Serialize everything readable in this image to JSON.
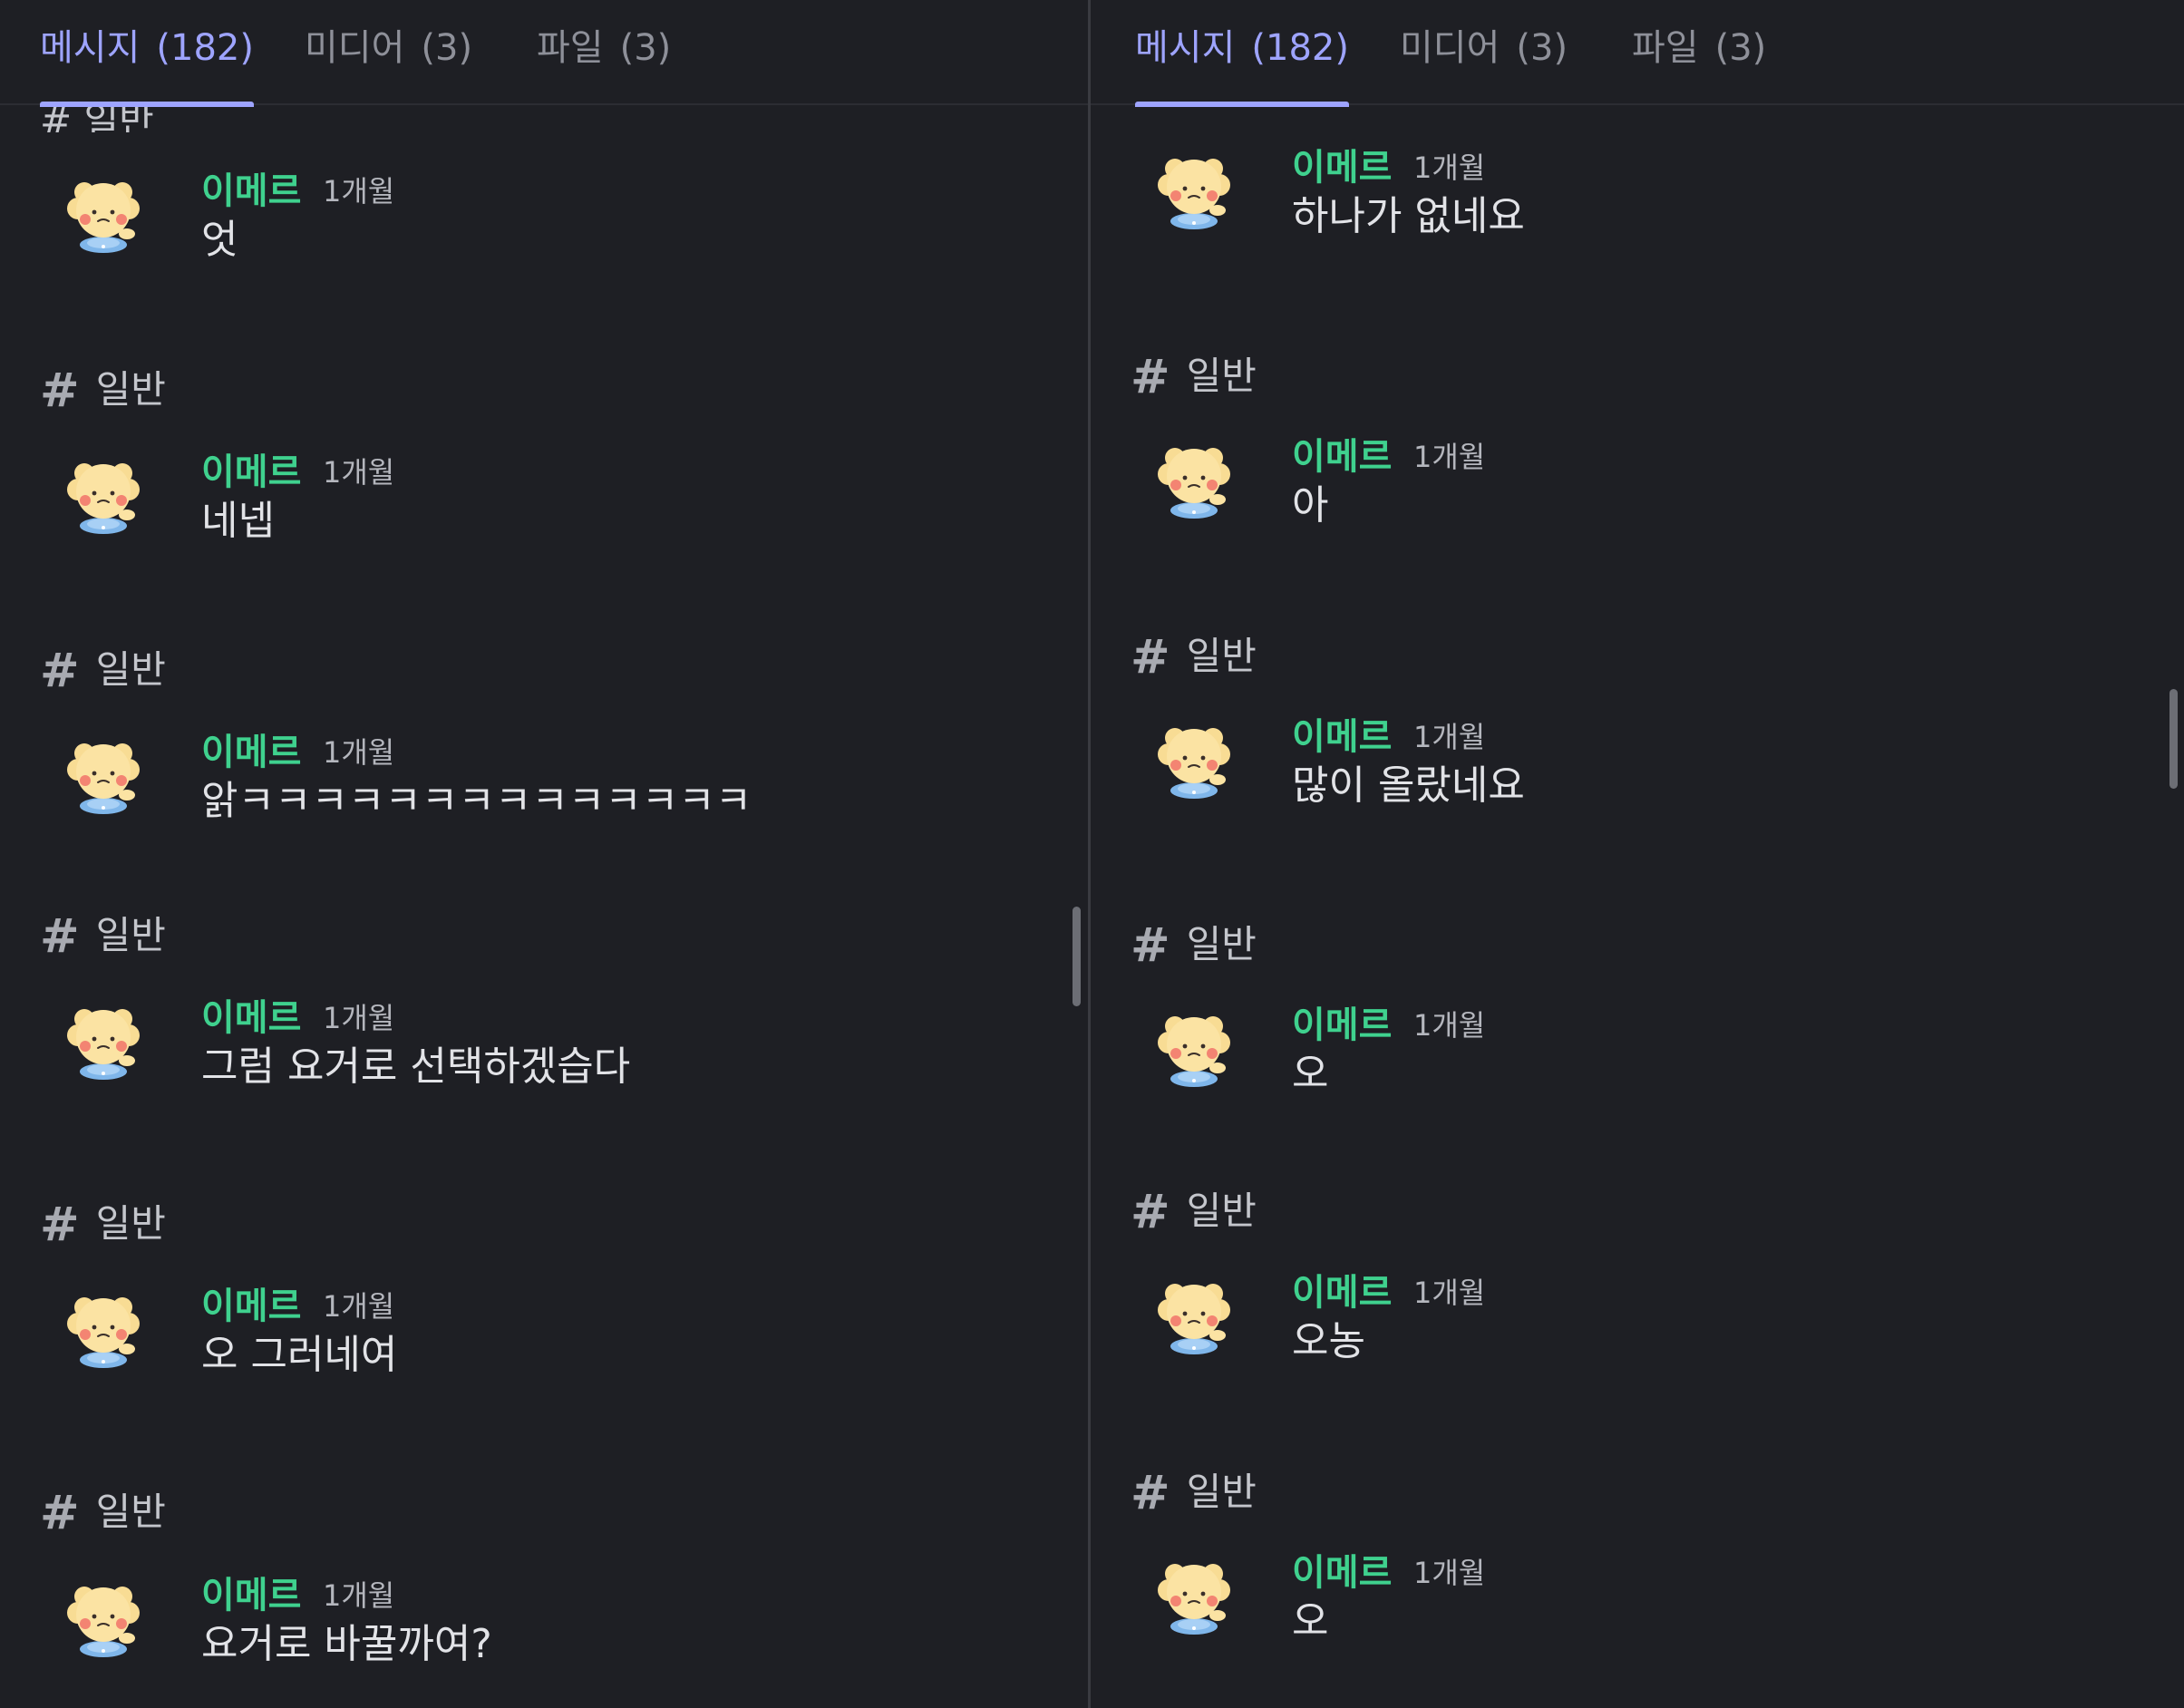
{
  "tabs": [
    {
      "label": "메시지",
      "count": "(182)",
      "active": true
    },
    {
      "label": "미디어",
      "count": "(3)",
      "active": false
    },
    {
      "label": "파일",
      "count": "(3)",
      "active": false
    }
  ],
  "left": {
    "partial_channel": "# 일반",
    "messages": [
      {
        "channel": "일반",
        "author": "이메르",
        "time": "1개월",
        "text": "엇"
      },
      {
        "channel": "일반",
        "author": "이메르",
        "time": "1개월",
        "text": "네넵"
      },
      {
        "channel": "일반",
        "author": "이메르",
        "time": "1개월",
        "text": "앍ㅋㅋㅋㅋㅋㅋㅋㅋㅋㅋㅋㅋㅋㅋ"
      },
      {
        "channel": "일반",
        "author": "이메르",
        "time": "1개월",
        "text": "그럼 요거로 선택하겠습다"
      },
      {
        "channel": "일반",
        "author": "이메르",
        "time": "1개월",
        "text": "오 그러네여"
      },
      {
        "channel": "일반",
        "author": "이메르",
        "time": "1개월",
        "text": "요거로 바꿀까여?"
      }
    ]
  },
  "right": {
    "messages": [
      {
        "channel": "",
        "author": "이메르",
        "time": "1개월",
        "text": "하나가 없네요"
      },
      {
        "channel": "일반",
        "author": "이메르",
        "time": "1개월",
        "text": "아"
      },
      {
        "channel": "일반",
        "author": "이메르",
        "time": "1개월",
        "text": "많이 올랐네요"
      },
      {
        "channel": "일반",
        "author": "이메르",
        "time": "1개월",
        "text": "오"
      },
      {
        "channel": "일반",
        "author": "이메르",
        "time": "1개월",
        "text": "오농"
      },
      {
        "channel": "일반",
        "author": "이메르",
        "time": "1개월",
        "text": "오"
      }
    ]
  },
  "icons": {
    "avatar": "bear-avatar-icon",
    "channel": "hash-icon"
  },
  "colors": {
    "background": "#1e1f24",
    "accent": "#9ea4ff",
    "author": "#3fd18e",
    "text": "#e2e3e7",
    "muted": "#8e9099"
  }
}
